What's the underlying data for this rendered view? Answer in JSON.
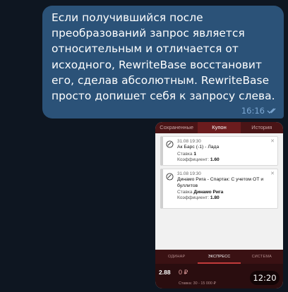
{
  "message": {
    "text": "Если получившийся после\nпреобразований запрос является\nотносительным и отличается от\nисходного, RewriteBase восстановит\nего, сделав абсолютным. RewriteBase\nпросто допишет себя к запросу слева.",
    "time": "16:16"
  },
  "app": {
    "tabs": [
      "Сохраненные",
      "Купон",
      "История"
    ],
    "bets": [
      {
        "date": "31.08 19:30",
        "event": "Ак Барс (-1) - Лада",
        "stake_label": "Ставка",
        "stake": "1",
        "coef_label": "Коэффициент:",
        "coef": "1.60"
      },
      {
        "date": "31.08 19:30",
        "event": "Динамо Рига - Спартак: С учетом ОТ и буллитов",
        "stake_label": "Ставка",
        "stake": "Динамо Рига",
        "coef_label": "Коэффициент:",
        "coef": "1.80"
      }
    ],
    "modes": [
      "ОДИНАР",
      "ЭКСПРЕСС",
      "СИСТЕМА"
    ],
    "total_coef": "2.88",
    "stake_value": "0 ₽",
    "stake_range": "Ставка: 30 - 15 000 ₽"
  },
  "media": {
    "time": "12:20"
  }
}
